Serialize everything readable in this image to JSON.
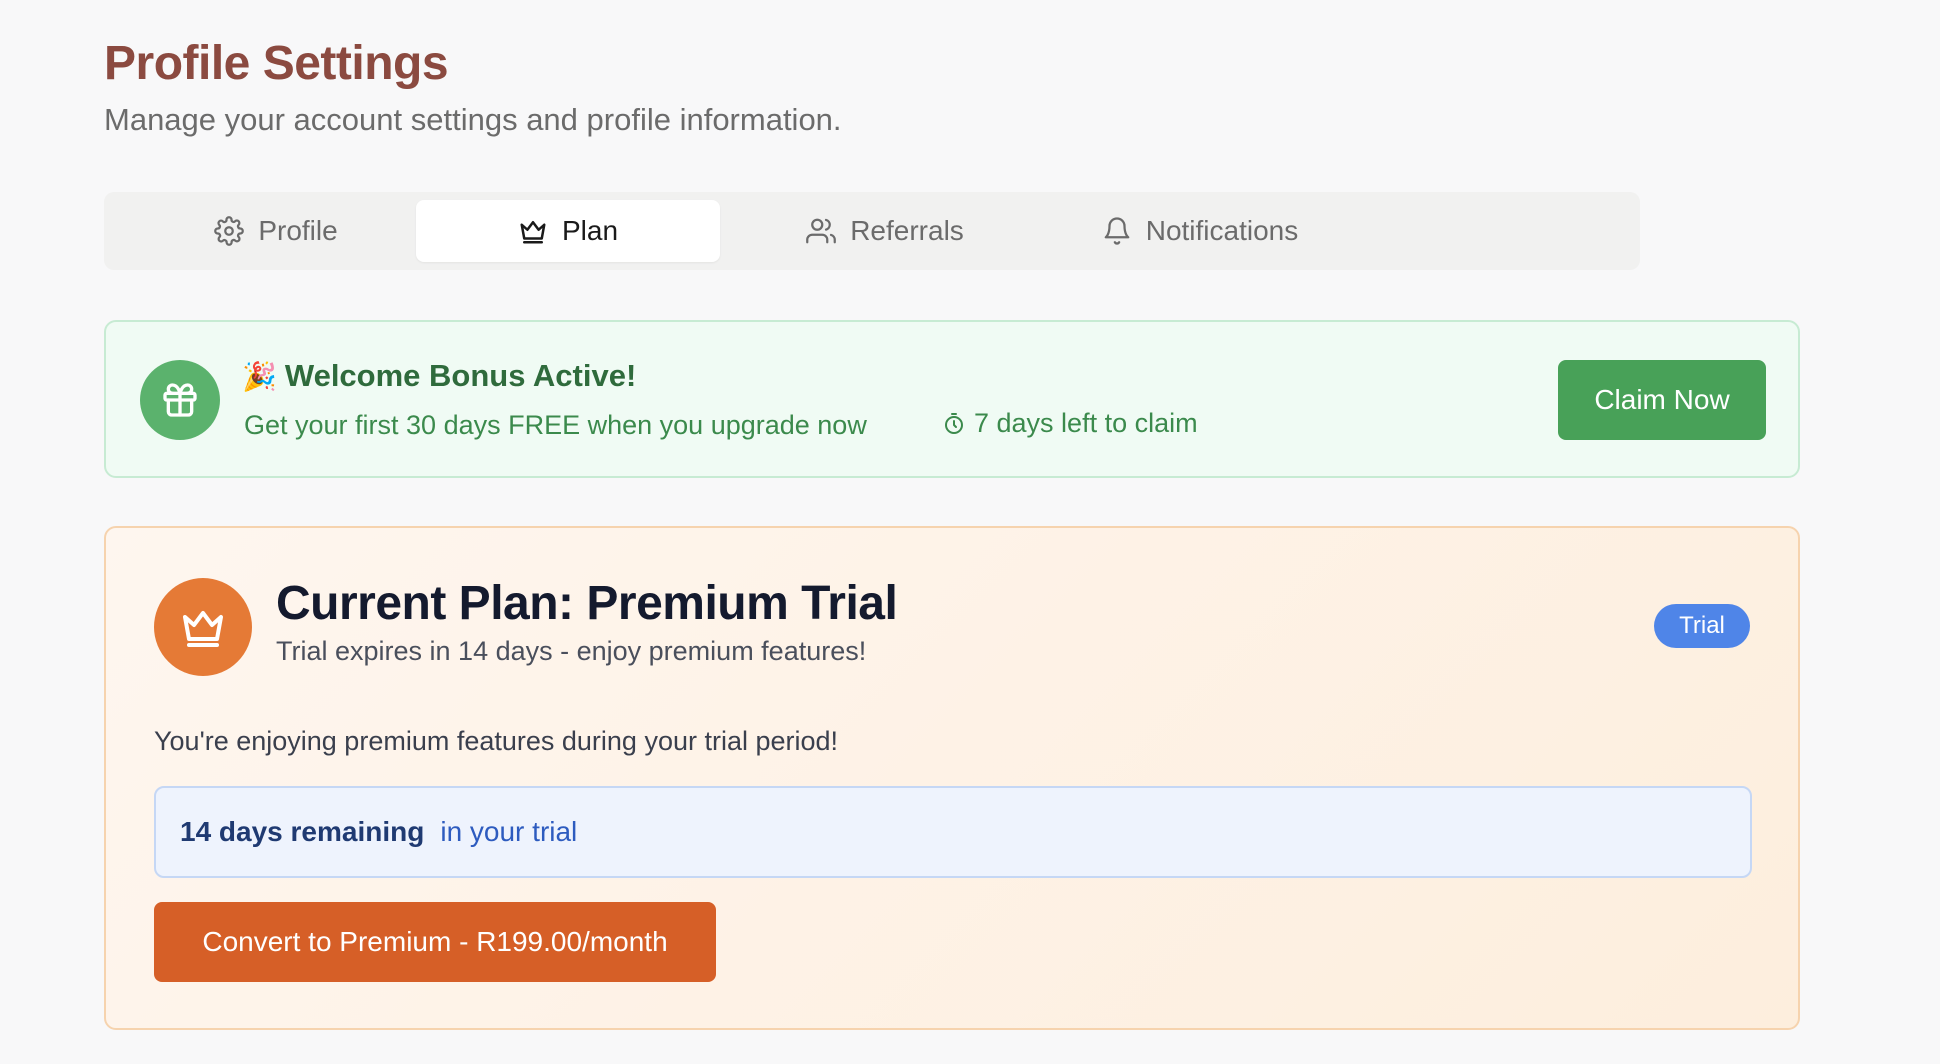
{
  "header": {
    "title": "Profile Settings",
    "subtitle": "Manage your account settings and profile information."
  },
  "tabs": [
    {
      "label": "Profile",
      "icon": "gear-icon",
      "active": false
    },
    {
      "label": "Plan",
      "icon": "crown-icon",
      "active": true
    },
    {
      "label": "Referrals",
      "icon": "users-icon",
      "active": false
    },
    {
      "label": "Notifications",
      "icon": "bell-icon",
      "active": false
    }
  ],
  "bonus": {
    "emoji": "🎉",
    "title": "Welcome Bonus Active!",
    "description": "Get your first 30 days FREE when you upgrade now",
    "timer": "7 days left to claim",
    "button": "Claim Now",
    "icon": "gift-icon",
    "accent_color": "#48a158"
  },
  "plan": {
    "icon": "crown-icon",
    "title": "Current Plan: Premium Trial",
    "subtitle": "Trial expires in 14 days - enjoy premium features!",
    "badge": "Trial",
    "message": "You're enjoying premium features during your trial period!",
    "remaining_strong": "14 days remaining",
    "remaining_rest": "in your trial",
    "convert_button": "Convert to Premium - R199.00/month",
    "accent_color": "#d65f27",
    "badge_color": "#4f85e8"
  }
}
